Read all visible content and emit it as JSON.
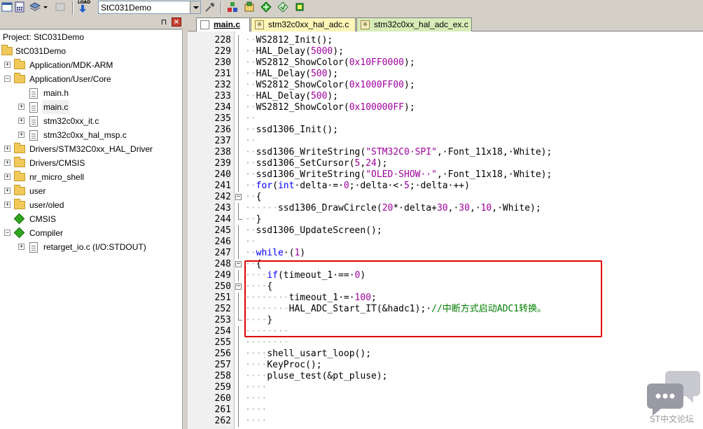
{
  "toolbar": {
    "target": "StC031Demo",
    "icons": [
      "window-icon",
      "calculator-icon",
      "layers-icon",
      "dropdown-arrow-icon",
      "build-disabled-icon",
      "load-icon",
      "target-options-icon",
      "manage-components-icon",
      "pack-installer-icon",
      "select-packs-icon",
      "event-recorder-icon",
      "cpu-icon"
    ],
    "load_label": "LOAD"
  },
  "project": {
    "title": "Project: StC031Demo",
    "pin": "⊓",
    "close": "×",
    "root": "StC031Demo",
    "items": [
      {
        "label": "Application/MDK-ARM",
        "type": "folder",
        "level": 1,
        "expander": "+"
      },
      {
        "label": "Application/User/Core",
        "type": "folder",
        "level": 1,
        "expander": "−"
      },
      {
        "label": "main.h",
        "type": "file",
        "level": 2,
        "expander": ""
      },
      {
        "label": "main.c",
        "type": "file",
        "level": 2,
        "expander": "+",
        "selected": true
      },
      {
        "label": "stm32c0xx_it.c",
        "type": "file",
        "level": 2,
        "expander": "+"
      },
      {
        "label": "stm32c0xx_hal_msp.c",
        "type": "file",
        "level": 2,
        "expander": "+"
      },
      {
        "label": "Drivers/STM32C0xx_HAL_Driver",
        "type": "folder",
        "level": 1,
        "expander": "+"
      },
      {
        "label": "Drivers/CMSIS",
        "type": "folder",
        "level": 1,
        "expander": "+"
      },
      {
        "label": "nr_micro_shell",
        "type": "folder",
        "level": 1,
        "expander": "+"
      },
      {
        "label": "user",
        "type": "folder",
        "level": 1,
        "expander": "+"
      },
      {
        "label": "user/oled",
        "type": "folder",
        "level": 1,
        "expander": "+"
      },
      {
        "label": "CMSIS",
        "type": "component",
        "level": 1,
        "expander": ""
      },
      {
        "label": "Compiler",
        "type": "component",
        "level": 1,
        "expander": "−"
      },
      {
        "label": "retarget_io.c (I/O:STDOUT)",
        "type": "file-key",
        "level": 2,
        "expander": "+"
      }
    ]
  },
  "tabs": [
    {
      "label": "main.c",
      "active": true
    },
    {
      "label": "stm32c0xx_hal_adc.c",
      "active": false
    },
    {
      "label": "stm32c0xx_hal_adc_ex.c",
      "active": false
    }
  ],
  "editor": {
    "lines": [
      {
        "n": "228",
        "fold": "line",
        "parts": [
          [
            "ws",
            "··"
          ],
          [
            "",
            "WS2812_Init();"
          ]
        ]
      },
      {
        "n": "229",
        "fold": "line",
        "parts": [
          [
            "ws",
            "··"
          ],
          [
            "",
            "HAL_Delay("
          ],
          [
            "num",
            "5000"
          ],
          [
            "",
            ");"
          ]
        ]
      },
      {
        "n": "230",
        "fold": "line",
        "parts": [
          [
            "ws",
            "··"
          ],
          [
            "",
            "WS2812_ShowColor("
          ],
          [
            "num",
            "0x10FF0000"
          ],
          [
            "",
            ");"
          ]
        ]
      },
      {
        "n": "231",
        "fold": "line",
        "parts": [
          [
            "ws",
            "··"
          ],
          [
            "",
            "HAL_Delay("
          ],
          [
            "num",
            "500"
          ],
          [
            "",
            ");"
          ]
        ]
      },
      {
        "n": "232",
        "fold": "line",
        "parts": [
          [
            "ws",
            "··"
          ],
          [
            "",
            "WS2812_ShowColor("
          ],
          [
            "num",
            "0x1000FF00"
          ],
          [
            "",
            ");"
          ]
        ]
      },
      {
        "n": "233",
        "fold": "line",
        "parts": [
          [
            "ws",
            "··"
          ],
          [
            "",
            "HAL_Delay("
          ],
          [
            "num",
            "500"
          ],
          [
            "",
            ");"
          ]
        ]
      },
      {
        "n": "234",
        "fold": "line",
        "parts": [
          [
            "ws",
            "··"
          ],
          [
            "",
            "WS2812_ShowColor("
          ],
          [
            "num",
            "0x100000FF"
          ],
          [
            "",
            ");"
          ]
        ]
      },
      {
        "n": "235",
        "fold": "line",
        "parts": [
          [
            "ws",
            "··"
          ]
        ]
      },
      {
        "n": "236",
        "fold": "line",
        "parts": [
          [
            "ws",
            "··"
          ],
          [
            "",
            "ssd1306_Init();"
          ]
        ]
      },
      {
        "n": "237",
        "fold": "line",
        "parts": [
          [
            "ws",
            "··"
          ]
        ]
      },
      {
        "n": "238",
        "fold": "line",
        "parts": [
          [
            "ws",
            "··"
          ],
          [
            "",
            "ssd1306_WriteString("
          ],
          [
            "str",
            "\"STM32C0·SPI\""
          ],
          [
            "",
            ",·Font_11x18,·White);"
          ]
        ]
      },
      {
        "n": "239",
        "fold": "line",
        "parts": [
          [
            "ws",
            "··"
          ],
          [
            "",
            "ssd1306_SetCursor("
          ],
          [
            "num",
            "5"
          ],
          [
            "",
            ","
          ],
          [
            "num",
            "24"
          ],
          [
            "",
            ");"
          ]
        ]
      },
      {
        "n": "240",
        "fold": "line",
        "parts": [
          [
            "ws",
            "··"
          ],
          [
            "",
            "ssd1306_WriteString("
          ],
          [
            "str",
            "\"OLED·SHOW··\""
          ],
          [
            "",
            ",·Font_11x18,·White);"
          ]
        ]
      },
      {
        "n": "241",
        "fold": "line",
        "parts": [
          [
            "ws",
            "··"
          ],
          [
            "kw",
            "for"
          ],
          [
            "",
            "("
          ],
          [
            "kw",
            "int"
          ],
          [
            "",
            "·delta·=·"
          ],
          [
            "num",
            "0"
          ],
          [
            "",
            ";·delta·<·"
          ],
          [
            "num",
            "5"
          ],
          [
            "",
            ";·delta·++)"
          ]
        ]
      },
      {
        "n": "242",
        "fold": "box",
        "parts": [
          [
            "ws",
            "··"
          ],
          [
            "",
            "{"
          ]
        ]
      },
      {
        "n": "243",
        "fold": "line",
        "parts": [
          [
            "ws",
            "······"
          ],
          [
            "",
            "ssd1306_DrawCircle("
          ],
          [
            "num",
            "20"
          ],
          [
            "",
            "*·delta+"
          ],
          [
            "num",
            "30"
          ],
          [
            "",
            ",·"
          ],
          [
            "num",
            "30"
          ],
          [
            "",
            ",·"
          ],
          [
            "num",
            "10"
          ],
          [
            "",
            ",·White);"
          ]
        ]
      },
      {
        "n": "244",
        "fold": "end",
        "parts": [
          [
            "ws",
            "··"
          ],
          [
            "",
            "}"
          ]
        ]
      },
      {
        "n": "245",
        "fold": "line",
        "parts": [
          [
            "ws",
            "··"
          ],
          [
            "",
            "ssd1306_UpdateScreen();"
          ]
        ]
      },
      {
        "n": "246",
        "fold": "line",
        "parts": [
          [
            "ws",
            "··"
          ]
        ]
      },
      {
        "n": "247",
        "fold": "line",
        "parts": [
          [
            "ws",
            "··"
          ],
          [
            "kw",
            "while"
          ],
          [
            "",
            "·("
          ],
          [
            "num",
            "1"
          ],
          [
            "",
            ")"
          ]
        ]
      },
      {
        "n": "248",
        "fold": "box",
        "parts": [
          [
            "ws",
            "··"
          ],
          [
            "",
            "{"
          ]
        ]
      },
      {
        "n": "249",
        "fold": "line",
        "parts": [
          [
            "ws",
            "····"
          ],
          [
            "kw",
            "if"
          ],
          [
            "",
            "(timeout_1·==·"
          ],
          [
            "num",
            "0"
          ],
          [
            "",
            ")"
          ]
        ]
      },
      {
        "n": "250",
        "fold": "box",
        "parts": [
          [
            "ws",
            "····"
          ],
          [
            "",
            "{"
          ]
        ]
      },
      {
        "n": "251",
        "fold": "line",
        "parts": [
          [
            "ws",
            "········"
          ],
          [
            "",
            "timeout_1·=·"
          ],
          [
            "num",
            "100"
          ],
          [
            "",
            ";"
          ]
        ]
      },
      {
        "n": "252",
        "fold": "line",
        "parts": [
          [
            "ws",
            "········"
          ],
          [
            "",
            "HAL_ADC_Start_IT(&hadc1);·"
          ],
          [
            "cmt",
            "//中断方式启动ADC1转换。"
          ]
        ]
      },
      {
        "n": "253",
        "fold": "end",
        "parts": [
          [
            "ws",
            "····"
          ],
          [
            "",
            "}"
          ]
        ]
      },
      {
        "n": "254",
        "fold": "line",
        "parts": [
          [
            "ws",
            "········"
          ]
        ]
      },
      {
        "n": "255",
        "fold": "line",
        "parts": [
          [
            "ws",
            "········"
          ]
        ]
      },
      {
        "n": "256",
        "fold": "line",
        "parts": [
          [
            "ws",
            "····"
          ],
          [
            "",
            "shell_usart_loop();"
          ]
        ]
      },
      {
        "n": "257",
        "fold": "line",
        "parts": [
          [
            "ws",
            "····"
          ],
          [
            "",
            "KeyProc();"
          ]
        ]
      },
      {
        "n": "258",
        "fold": "line",
        "parts": [
          [
            "ws",
            "····"
          ],
          [
            "",
            "pluse_test(&pt_pluse);"
          ]
        ]
      },
      {
        "n": "259",
        "fold": "line",
        "parts": [
          [
            "ws",
            "····"
          ]
        ]
      },
      {
        "n": "260",
        "fold": "line",
        "parts": [
          [
            "ws",
            "····"
          ]
        ]
      },
      {
        "n": "261",
        "fold": "line",
        "parts": [
          [
            "ws",
            "····"
          ]
        ]
      },
      {
        "n": "262",
        "fold": "line",
        "parts": [
          [
            "ws",
            "····"
          ]
        ]
      }
    ]
  },
  "watermark": {
    "text": "ST中文论坛",
    "icon": "chat-bubbles-icon"
  },
  "colors": {
    "keyword": "#0000ff",
    "number": "#a000a0",
    "comment": "#008000",
    "highlight": "#e00000"
  }
}
